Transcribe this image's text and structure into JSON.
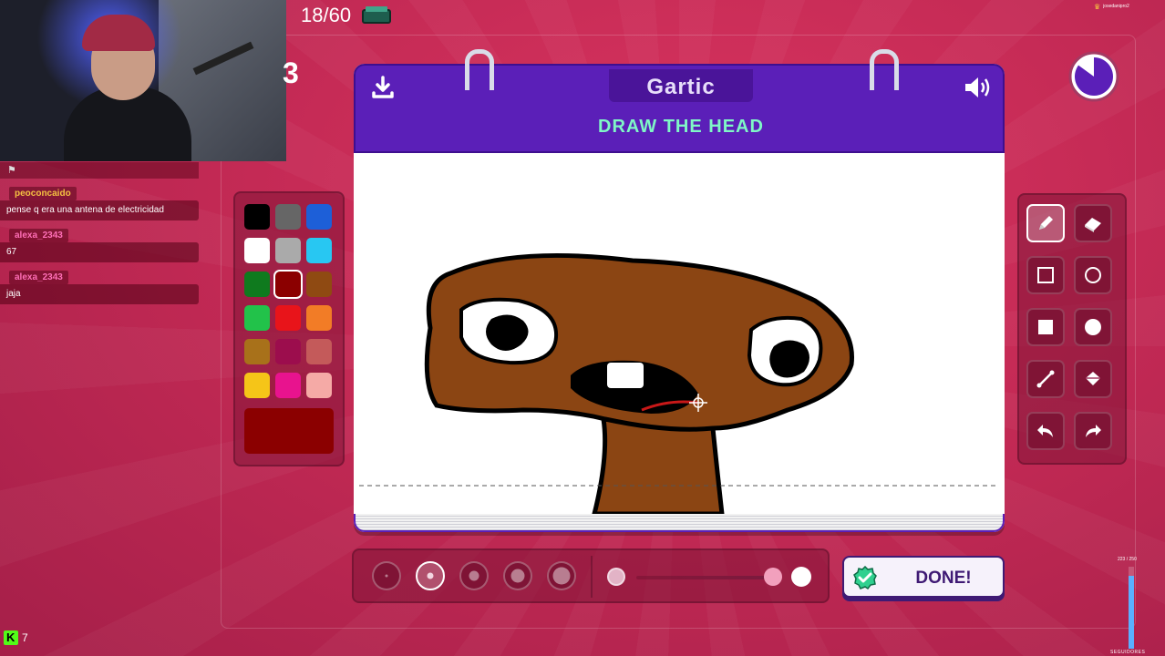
{
  "game": {
    "round": "18/60",
    "side_number": "3",
    "logo": "Gartic",
    "instruction": "DRAW THE HEAD",
    "done_label": "DONE!",
    "timer_fraction_remaining": 0.85
  },
  "chat": {
    "messages": [
      {
        "user": "peoconcaido",
        "user_color": "#f5c242",
        "text": "pense q era una antena de electricidad"
      },
      {
        "user": "alexa_2343",
        "user_color": "#ff6fb7",
        "text": "67"
      },
      {
        "user": "alexa_2343",
        "user_color": "#ff6fb7",
        "text": "jaja"
      }
    ]
  },
  "palette": {
    "colors": [
      "#000000",
      "#666666",
      "#1d5fd8",
      "#ffffff",
      "#aaaaaa",
      "#28c7f2",
      "#0f7a1e",
      "#8b0000",
      "#8f4a12",
      "#22c24a",
      "#e8141a",
      "#f27c26",
      "#a8711a",
      "#9c0d4d",
      "#c45a5a",
      "#f5c518",
      "#e8138e",
      "#f5aaa6"
    ],
    "selected_index": 7,
    "current_color": "#8b0000"
  },
  "tools": {
    "items": [
      "pencil-icon",
      "eraser-icon",
      "rect-outline-icon",
      "ellipse-outline-icon",
      "rect-fill-icon",
      "ellipse-fill-icon",
      "line-icon",
      "fill-bucket-icon",
      "undo-icon",
      "redo-icon"
    ],
    "selected": "pencil-icon"
  },
  "brush": {
    "sizes": 5,
    "selected_size_index": 1,
    "opacity": 1.0
  },
  "overlay": {
    "viewers": "7",
    "top_user": "josedanipro2",
    "goal_text": "223 / 250",
    "goal_fraction": 0.89,
    "goal_label": "SEGUIDORES"
  }
}
